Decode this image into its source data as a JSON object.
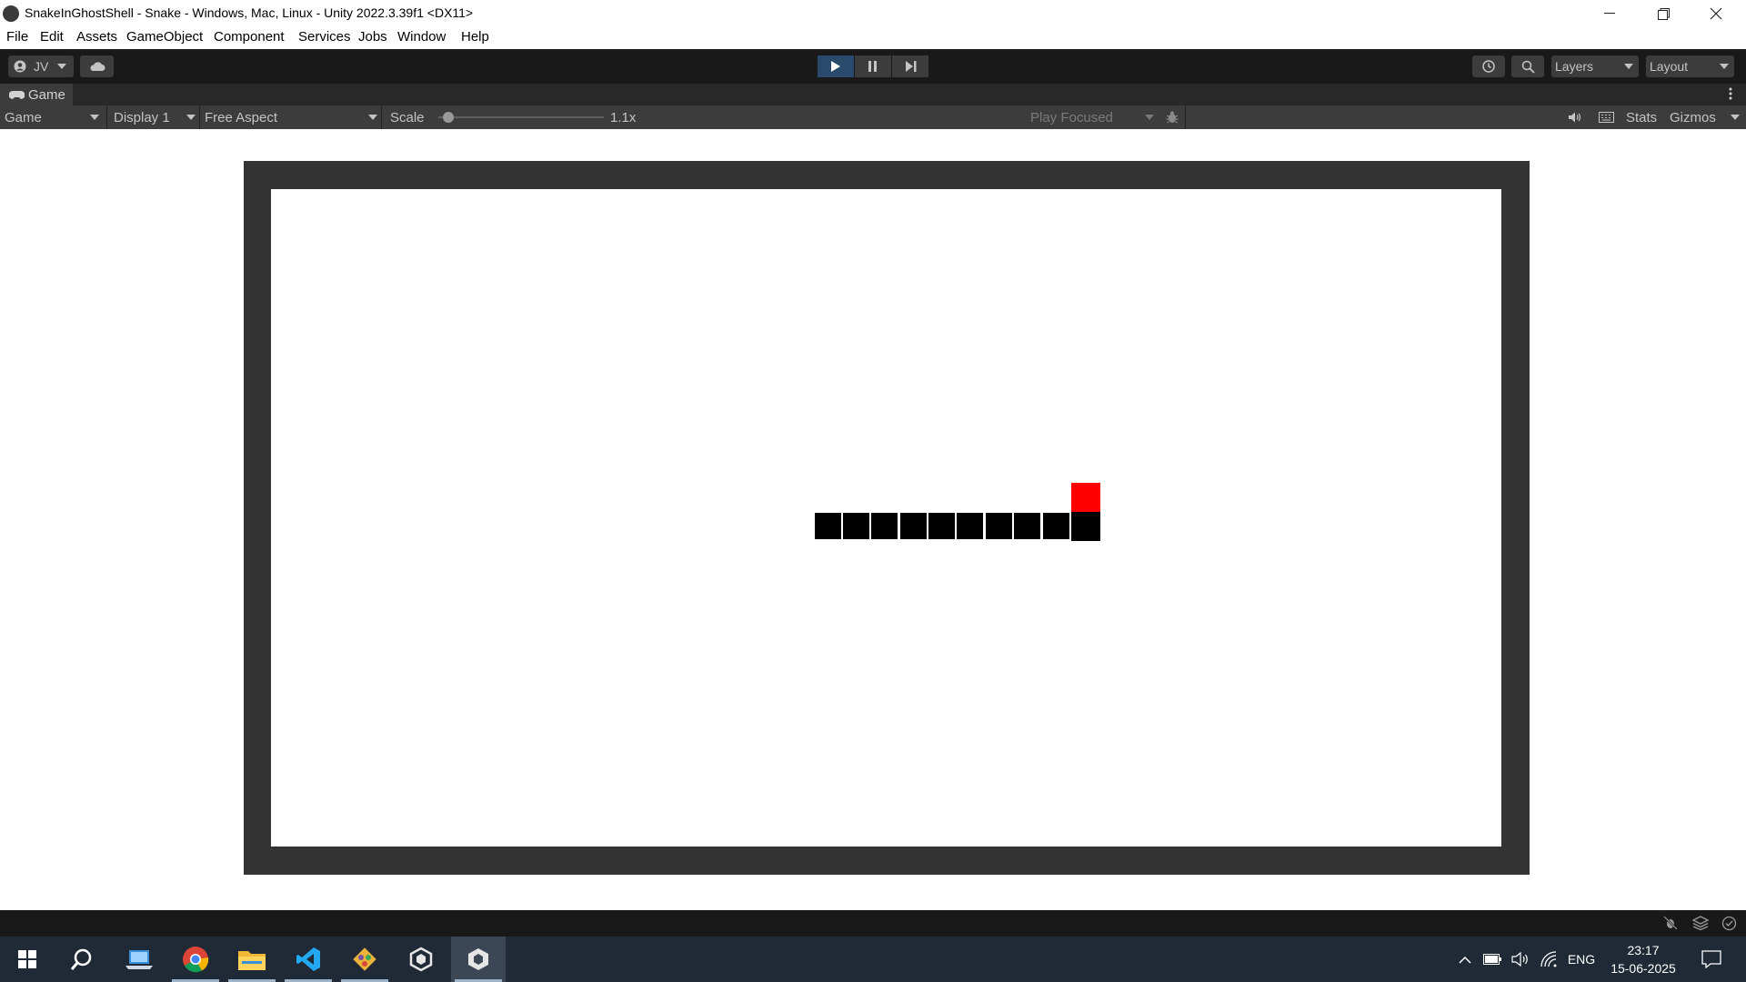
{
  "window": {
    "title": "SnakeInGhostShell - Snake - Windows, Mac, Linux - Unity 2022.3.39f1 <DX11>"
  },
  "menu": [
    "File",
    "Edit",
    "Assets",
    "GameObject",
    "Component",
    "Services",
    "Jobs",
    "Window",
    "Help"
  ],
  "toolbar": {
    "account_label": "JV",
    "layers_label": "Layers",
    "layout_label": "Layout",
    "play_state": "playing"
  },
  "game_tab": {
    "tab_label": "Game",
    "view_mode": "Game",
    "display": "Display 1",
    "aspect": "Free Aspect",
    "scale_label": "Scale",
    "scale_value": "1.1x",
    "scale_fraction": 0.03,
    "play_focused": "Play Focused",
    "stats_label": "Stats",
    "gizmos_label": "Gizmos"
  },
  "game": {
    "board_color": "#ffffff",
    "border_color": "#333333",
    "snake_color": "#000000",
    "food_color": "#ff0000",
    "snake_length": 10,
    "food_relative_to_head": "above"
  },
  "taskbar": {
    "apps": [
      {
        "name": "start",
        "icon": "windows-icon"
      },
      {
        "name": "search",
        "icon": "search-icon"
      },
      {
        "name": "file-app",
        "icon": "laptop-icon"
      },
      {
        "name": "chrome",
        "icon": "chrome-icon"
      },
      {
        "name": "file-explorer",
        "icon": "folder-icon"
      },
      {
        "name": "vscode",
        "icon": "vscode-icon"
      },
      {
        "name": "git",
        "icon": "git-icon"
      },
      {
        "name": "unity-hub",
        "icon": "unity-icon"
      },
      {
        "name": "unity-editor",
        "icon": "unity-icon"
      }
    ],
    "language": "ENG",
    "time": "23:17",
    "date": "15-06-2025"
  },
  "colors": {
    "toolbar_bg": "#191919",
    "panel_bg": "#3c3c3c",
    "play_active": "#294a6b",
    "taskbar_bg": "#1f2a36"
  }
}
